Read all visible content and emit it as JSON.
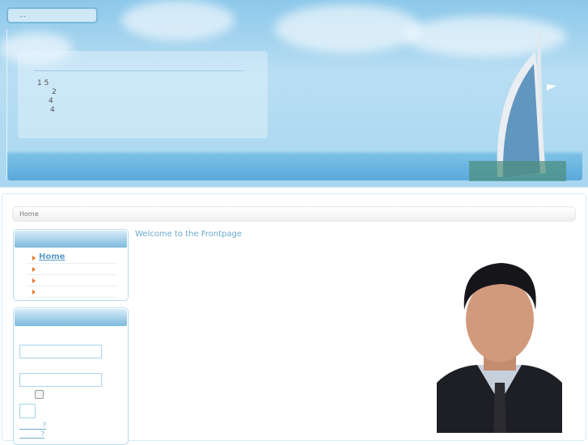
{
  "header": {
    "search_text": "...",
    "info_lines": [
      "1  5",
      "2",
      "4",
      "4"
    ]
  },
  "breadcrumb": {
    "current": "Home"
  },
  "main_menu": {
    "items": [
      {
        "label": "Home",
        "active": true
      },
      {
        "label": ""
      },
      {
        "label": ""
      },
      {
        "label": ""
      }
    ]
  },
  "login": {
    "remember_checked": false,
    "links": [
      "?",
      "?"
    ]
  },
  "content": {
    "title": "Welcome to the Frontpage"
  },
  "colors": {
    "accent": "#69a8cf",
    "bullet": "#e8742a"
  }
}
